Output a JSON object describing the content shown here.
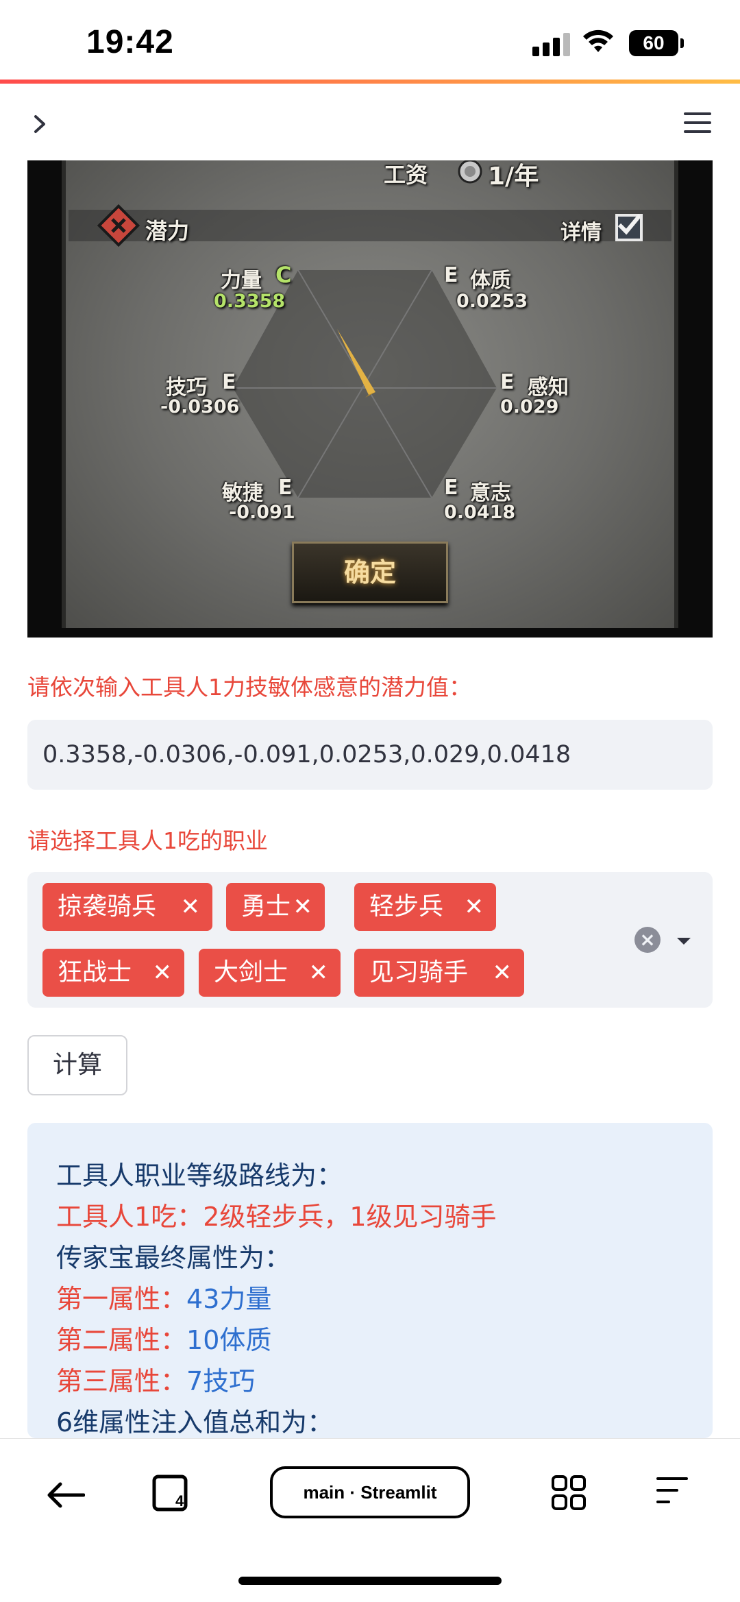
{
  "status_bar": {
    "time": "19:42",
    "battery": "60"
  },
  "browser": {
    "url_label": "main · Streamlit"
  },
  "game": {
    "salary_label": "工资",
    "salary_value": "1/年",
    "section_title": "潜力",
    "details_label": "详情",
    "confirm_label": "确定",
    "stats": [
      {
        "name": "力量",
        "grade": "C",
        "value": "0.3358"
      },
      {
        "name": "体质",
        "grade": "E",
        "value": "0.0253"
      },
      {
        "name": "技巧",
        "grade": "E",
        "value": "-0.0306"
      },
      {
        "name": "感知",
        "grade": "E",
        "value": "0.029"
      },
      {
        "name": "敏捷",
        "grade": "E",
        "value": "-0.091"
      },
      {
        "name": "意志",
        "grade": "E",
        "value": "0.0418"
      }
    ]
  },
  "form": {
    "potential_label": "请依次输入工具人1力技敏体感意的潜力值：",
    "potential_value": "0.3358,-0.0306,-0.091,0.0253,0.029,0.0418",
    "job_label": "请选择工具人1吃的职业",
    "selected_jobs": [
      "掠袭骑兵",
      "勇士",
      "轻步兵",
      "狂战士",
      "大剑士",
      "见习骑手"
    ],
    "calculate_label": "计算"
  },
  "result": {
    "route_title": "工具人职业等级路线为：",
    "route_prefix": "工具人1吃：",
    "route_value": "2级轻步兵，1级见习骑手",
    "final_title": "传家宝最终属性为：",
    "attributes": [
      {
        "label": "第一属性：",
        "value": "43力量"
      },
      {
        "label": "第二属性：",
        "value": "10体质"
      },
      {
        "label": "第三属性：",
        "value": "7技巧"
      }
    ],
    "sum_title": "6维属性注入值总和为："
  },
  "colors": {
    "accent_red": "#e8473a",
    "tag_red": "#ea4f47",
    "info_bg": "#e8f0fa",
    "info_text": "#173a6b",
    "info_blue": "#2e6fcf"
  }
}
